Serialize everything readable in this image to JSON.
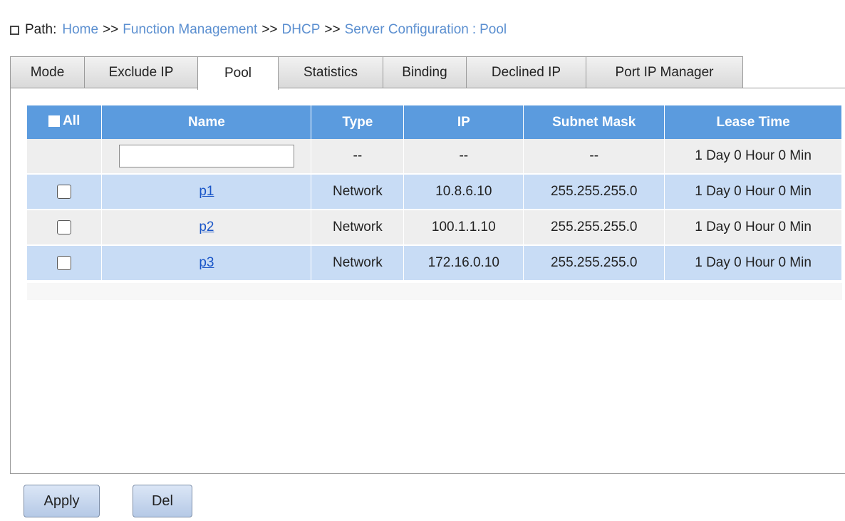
{
  "path": {
    "label": "Path:",
    "crumbs": [
      "Home",
      "Function Management",
      "DHCP",
      "Server Configuration"
    ],
    "separator": ">>",
    "colon": ":",
    "current": "Pool"
  },
  "tabs": [
    {
      "label": "Mode"
    },
    {
      "label": "Exclude IP"
    },
    {
      "label": "Pool",
      "active": true
    },
    {
      "label": "Statistics"
    },
    {
      "label": "Binding"
    },
    {
      "label": "Declined IP"
    },
    {
      "label": "Port IP Manager"
    }
  ],
  "table": {
    "columns": [
      "All",
      "Name",
      "Type",
      "IP",
      "Subnet Mask",
      "Lease Time"
    ],
    "new_row": {
      "name_value": "",
      "type": "--",
      "ip": "--",
      "mask": "--",
      "lease": "1 Day 0 Hour 0 Min"
    },
    "rows": [
      {
        "name": "p1",
        "type": "Network",
        "ip": "10.8.6.10",
        "mask": "255.255.255.0",
        "lease": "1 Day 0 Hour 0 Min",
        "checked": false
      },
      {
        "name": "p2",
        "type": "Network",
        "ip": "100.1.1.10",
        "mask": "255.255.255.0",
        "lease": "1 Day 0 Hour 0 Min",
        "checked": false
      },
      {
        "name": "p3",
        "type": "Network",
        "ip": "172.16.0.10",
        "mask": "255.255.255.0",
        "lease": "1 Day 0 Hour 0 Min",
        "checked": false
      }
    ]
  },
  "buttons": {
    "apply": "Apply",
    "del": "Del"
  },
  "colors": {
    "header": "#5b9bde",
    "row_blue": "#c8dcf5",
    "row_grey": "#eeeeee",
    "link": "#1a56c8",
    "path_link": "#5b8fd0"
  }
}
